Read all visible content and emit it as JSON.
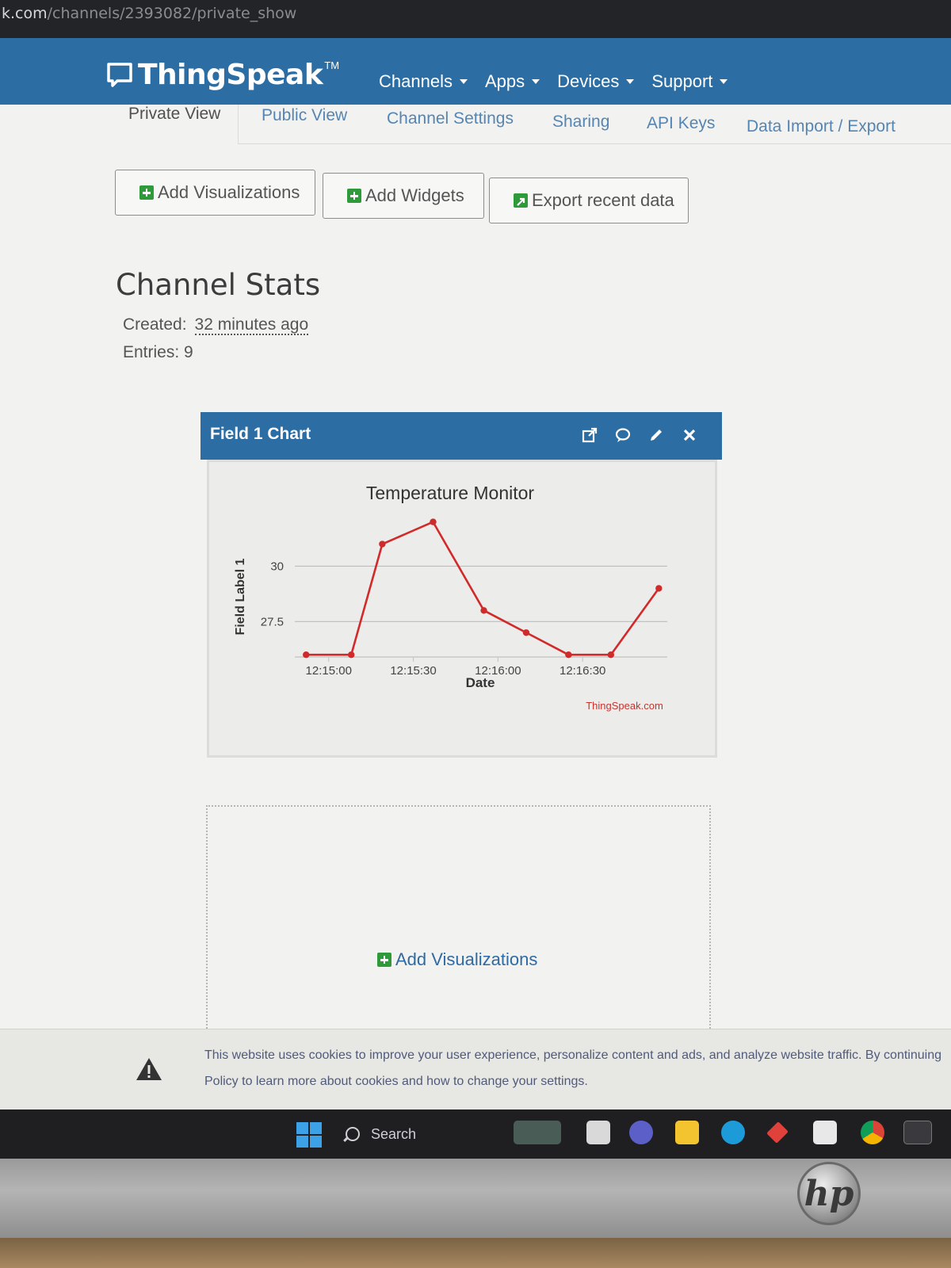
{
  "browser": {
    "url_host": "k.com",
    "url_path": "/channels/2393082/private_show"
  },
  "navbar": {
    "brand": "ThingSpeak",
    "brand_tm": "TM",
    "menu": [
      "Channels",
      "Apps",
      "Devices",
      "Support"
    ]
  },
  "tabs": [
    "Private View",
    "Public View",
    "Channel Settings",
    "Sharing",
    "API Keys",
    "Data Import / Export"
  ],
  "actions": {
    "add_visualizations": "Add Visualizations",
    "add_widgets": "Add Widgets",
    "export_recent": "Export recent data"
  },
  "stats": {
    "title": "Channel Stats",
    "created_label": "Created:",
    "created_value": "32 minutes ago",
    "entries_label": "Entries: 9"
  },
  "widget": {
    "title": "Field 1 Chart",
    "icons": [
      "external-link-icon",
      "comment-icon",
      "pencil-icon",
      "close-icon"
    ]
  },
  "chart_data": {
    "type": "line",
    "title": "Temperature Monitor",
    "xlabel": "Date",
    "ylabel": "Field Label 1",
    "credit": "ThingSpeak.com",
    "x_ticks": [
      "12:15:00",
      "12:15:30",
      "12:16:00",
      "12:16:30"
    ],
    "y_ticks": [
      "27.5",
      "30"
    ],
    "x": [
      "12:14:52",
      "12:15:08",
      "12:15:19",
      "12:15:37",
      "12:15:55",
      "12:16:10",
      "12:16:25",
      "12:16:40",
      "12:16:57"
    ],
    "values": [
      26.0,
      26.0,
      31.0,
      32.0,
      28.0,
      27.0,
      26.0,
      26.0,
      29.0
    ],
    "ylim": [
      25.9,
      32.2
    ],
    "color": "#d12a2a",
    "grid": true
  },
  "empty_panel": {
    "link": "Add Visualizations"
  },
  "cookie": {
    "line1": "This website uses cookies to improve your user experience, personalize content and ads, and analyze website traffic. By continuing",
    "line2": "Policy to learn more about cookies and how to change your settings."
  },
  "taskbar": {
    "search_label": "Search"
  },
  "bezel": {
    "brand": "hp"
  }
}
